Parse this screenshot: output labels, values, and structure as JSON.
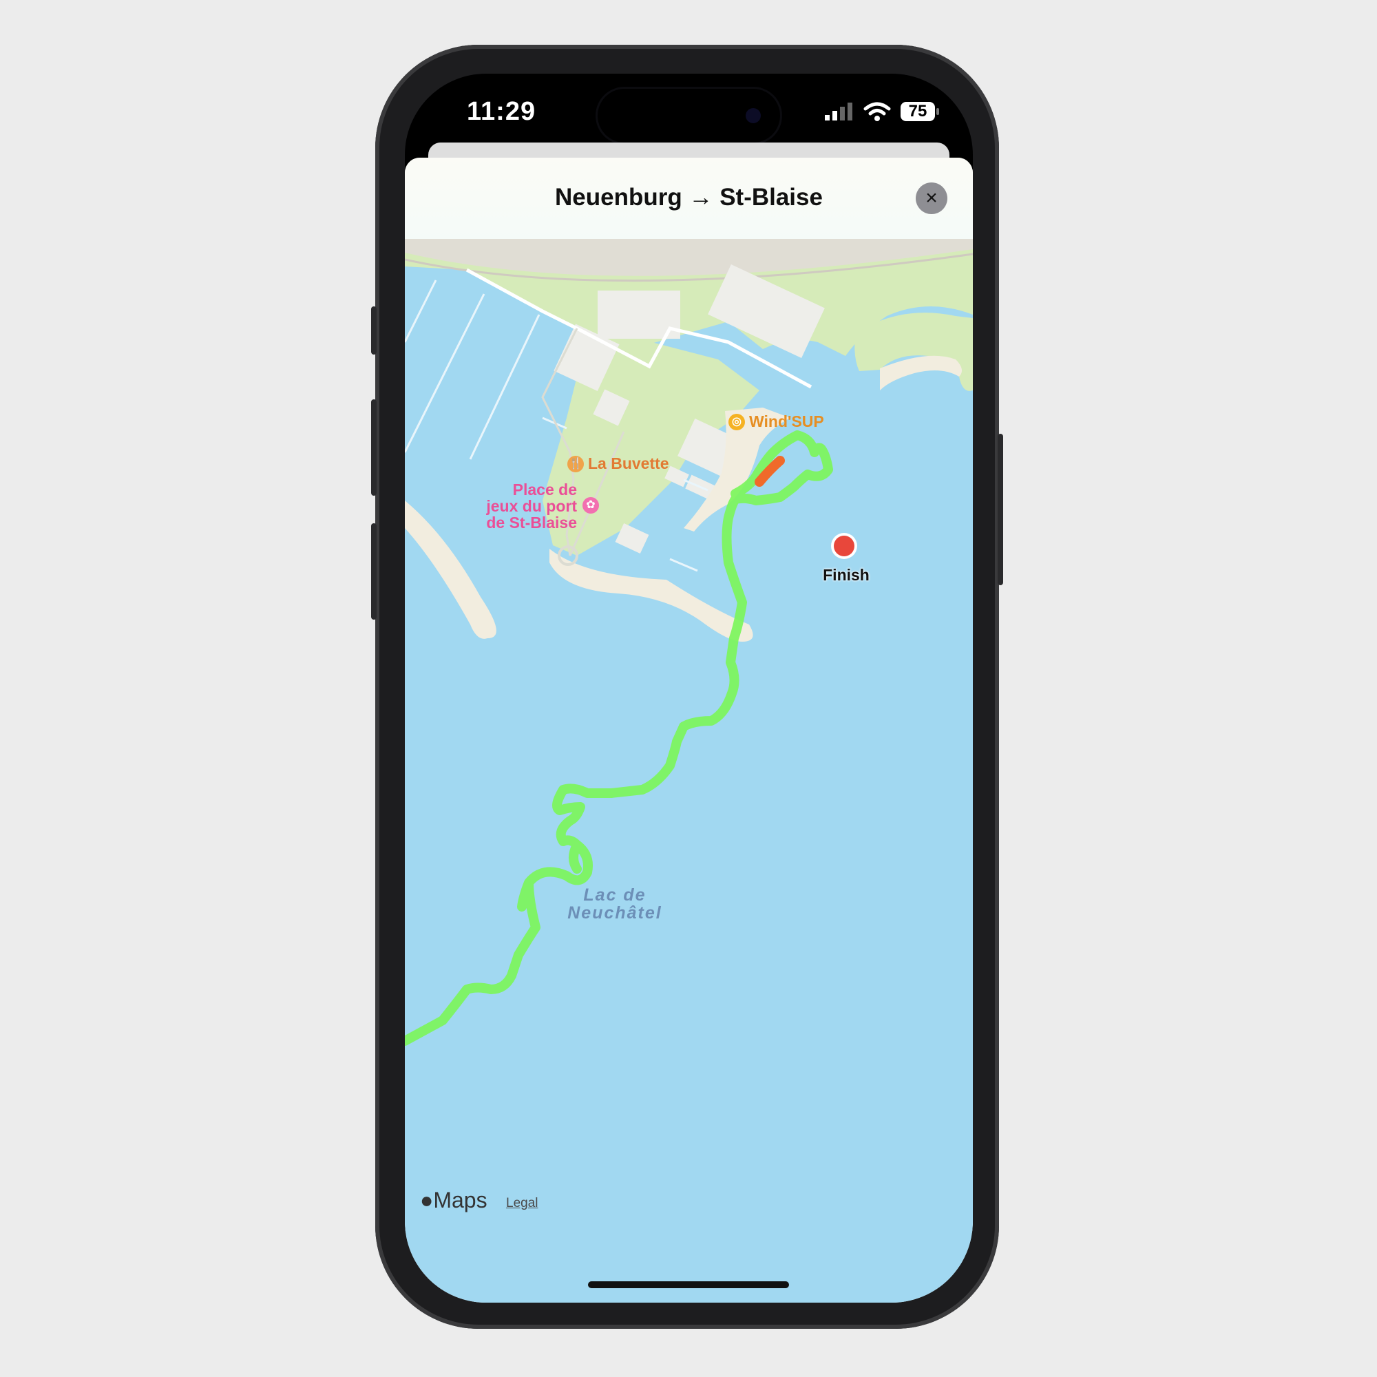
{
  "status_bar": {
    "time": "11:29",
    "battery": "75"
  },
  "sheet": {
    "title": "Neuenburg → St-Blaise",
    "close_icon": "×"
  },
  "map": {
    "pois": {
      "windsup": "Wind'SUP",
      "buvette": "La Buvette",
      "playground_line1": "Place de",
      "playground_line2": "jeux du port",
      "playground_line3": "de St-Blaise"
    },
    "lake_line1": "Lac de",
    "lake_line2": "Neuchâtel",
    "finish_label": "Finish",
    "attribution": "Maps",
    "legal": "Legal"
  },
  "colors": {
    "water": "#a1d8f1",
    "land": "#d6ebb9",
    "route": "#7cf55b",
    "finish": "#e8473b"
  }
}
